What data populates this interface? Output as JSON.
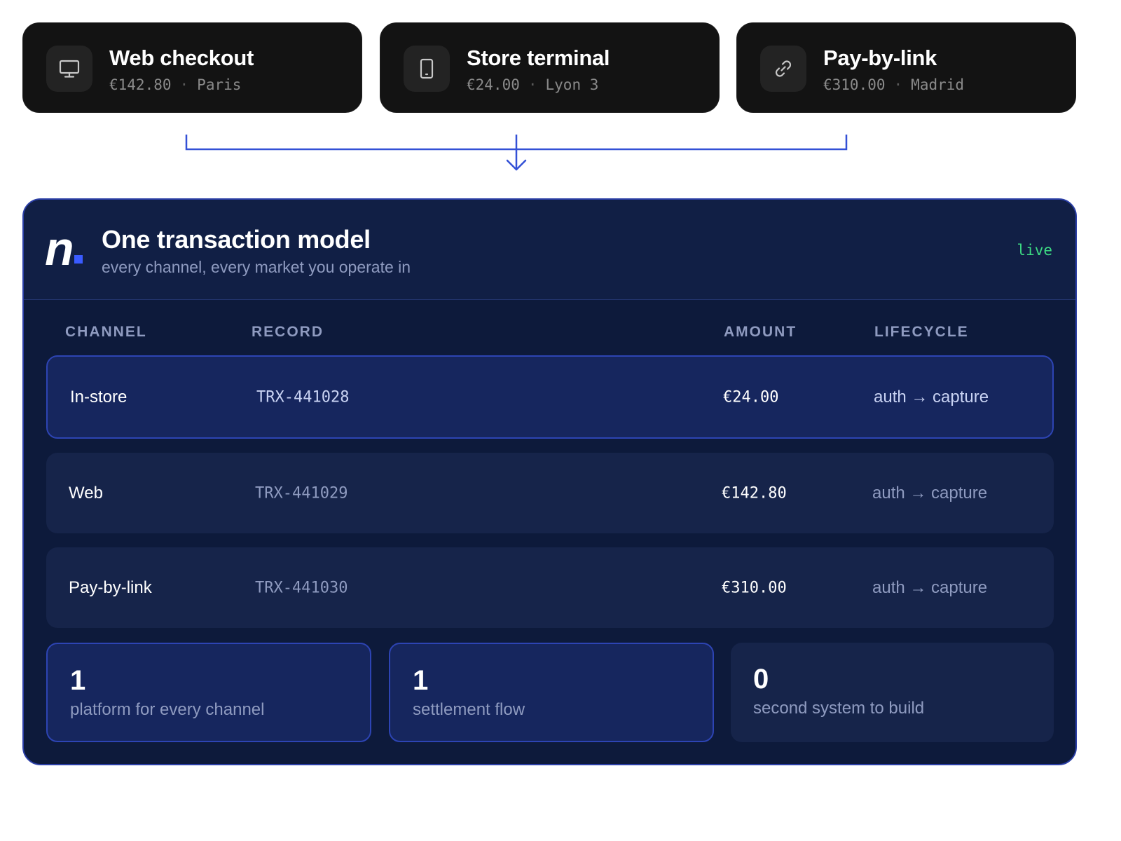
{
  "channels": [
    {
      "title": "Web checkout",
      "amount": "€142.80",
      "separator": "·",
      "place": "Paris",
      "icon": "monitor-icon"
    },
    {
      "title": "Store terminal",
      "amount": "€24.00",
      "separator": "·",
      "place": "Lyon 3",
      "icon": "tablet-icon"
    },
    {
      "title": "Pay-by-link",
      "amount": "€310.00",
      "separator": "·",
      "place": "Madrid",
      "icon": "link-icon"
    }
  ],
  "panel": {
    "logo": "n",
    "title": "One transaction model",
    "subtitle": "every channel, every market you operate in",
    "status": "live"
  },
  "table": {
    "headers": [
      "CHANNEL",
      "RECORD",
      "AMOUNT",
      "LIFECYCLE"
    ],
    "rows": [
      {
        "channel": "In-store",
        "record": "TRX-441028",
        "amount": "€24.00",
        "lifecycle": "auth → capture",
        "highlighted": true
      },
      {
        "channel": "Web",
        "record": "TRX-441029",
        "amount": "€142.80",
        "lifecycle": "auth → capture",
        "highlighted": false
      },
      {
        "channel": "Pay-by-link",
        "record": "TRX-441030",
        "amount": "€310.00",
        "lifecycle": "auth → capture",
        "highlighted": false
      }
    ]
  },
  "stats": [
    {
      "value": "1",
      "label": "platform for every channel"
    },
    {
      "value": "1",
      "label": "settlement flow"
    },
    {
      "value": "0",
      "label": "second system to build"
    }
  ],
  "colors": {
    "accent": "#3a5bff",
    "connector": "#3350d6",
    "live": "#3ddc84",
    "panel_bg": "#0d1a3b"
  }
}
